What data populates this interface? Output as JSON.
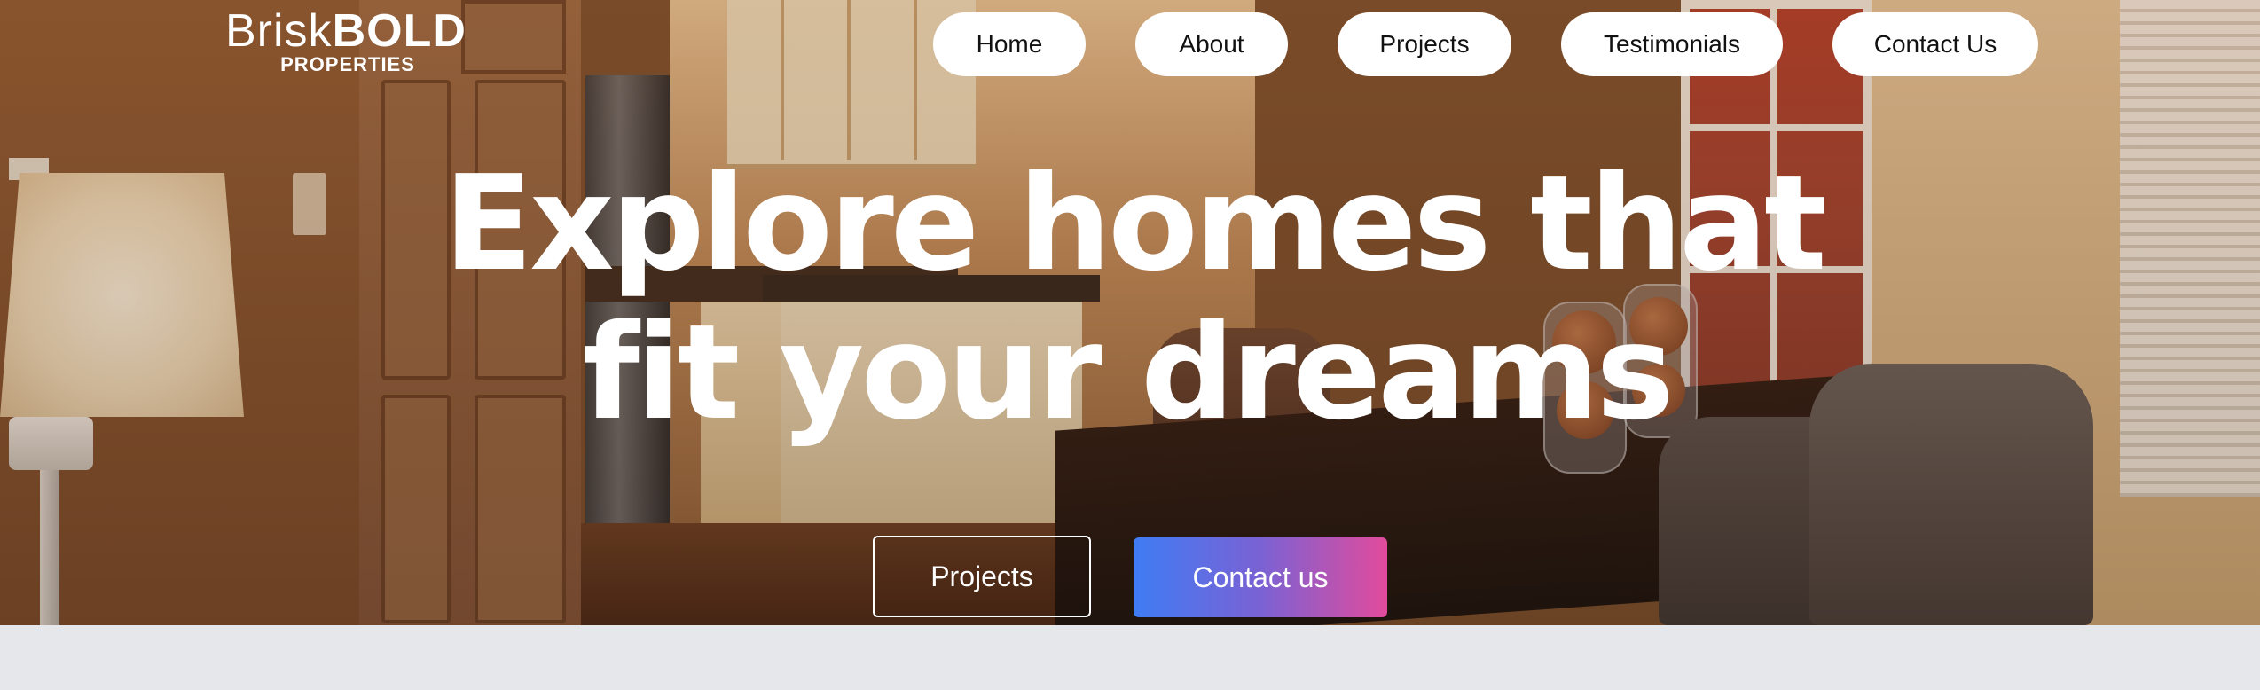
{
  "brand": {
    "logo_light": "Brisk",
    "logo_bold": "BOLD",
    "logo_sub": "PROPERTIES"
  },
  "nav": {
    "items": [
      {
        "label": "Home"
      },
      {
        "label": "About"
      },
      {
        "label": "Projects"
      },
      {
        "label": "Testimonials"
      },
      {
        "label": "Contact Us"
      }
    ]
  },
  "hero": {
    "headline_line1": "Explore homes that",
    "headline_line2": "fit your dreams",
    "primary_cta": "Projects",
    "secondary_cta": "Contact us",
    "background": "photo-kitchen-dining-interior"
  },
  "colors": {
    "nav_bg": "#ffffff",
    "cta_gradient_start": "#3f7cf4",
    "cta_gradient_end": "#e24b9c",
    "page_bg": "#e5e7eb"
  }
}
